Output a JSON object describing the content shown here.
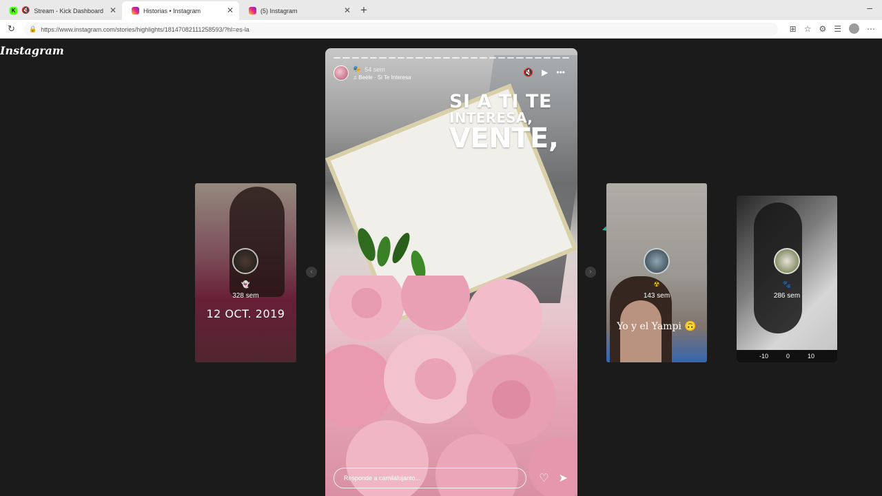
{
  "browser": {
    "tabs": [
      {
        "title": "Stream - Kick Dashboard",
        "favicon": "kick-logo",
        "muted": true
      },
      {
        "title": "Historias • Instagram",
        "favicon": "instagram-logo",
        "active": true
      },
      {
        "title": "(5) Instagram",
        "favicon": "instagram-logo"
      }
    ],
    "url": "https://www.instagram.com/stories/highlights/18147082111258593/?hl=es-la"
  },
  "instagram": {
    "logo": "Instagram",
    "main_story": {
      "time": "54 sem",
      "music": "Beéle · Si Te Interesa",
      "headline": [
        "SI A TI TE",
        "INTERESA,",
        "VENTE,"
      ],
      "reply_placeholder": "Responde a camilalujanto...",
      "progress_segments": 26
    },
    "side_stories": [
      {
        "time": "328 sem",
        "caption": "12 OCT. 2019"
      },
      {
        "time": "143 sem",
        "caption": "Yo y el Yampi 🙃"
      },
      {
        "time": "286 sem",
        "ruler_values": [
          "-10",
          "0",
          "10"
        ]
      }
    ]
  }
}
